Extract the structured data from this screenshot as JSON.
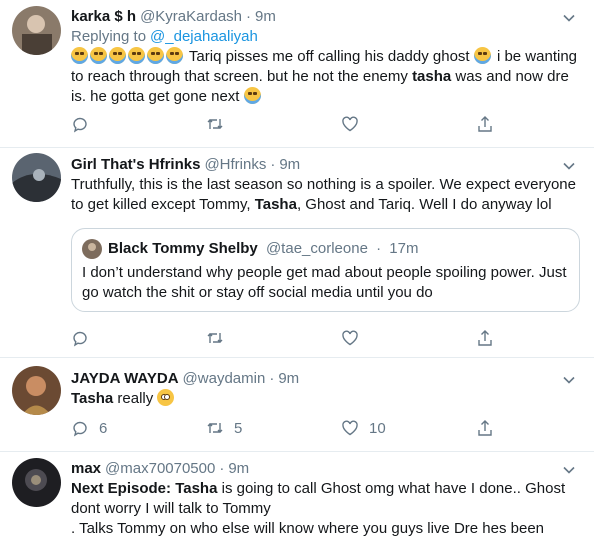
{
  "tweets": [
    {
      "name": "karka",
      "name_suffix": "$ h",
      "handle": "@KyraKardash",
      "dot": "·",
      "time": "9m",
      "replying_label": "Replying to",
      "replying_to": "@_dejahaaliyah",
      "text_parts": [
        " Tariq pisses me off calling his daddy ghost ",
        " i be wanting to reach through that screen. but he not the enemy ",
        "tasha",
        " was and now dre is. he gotta get gone next "
      ],
      "emoji": "loudly-crying-face",
      "actions": {
        "reply": "",
        "retweet": "",
        "like": ""
      }
    },
    {
      "name": "Girl That's Hfrinks",
      "handle": "@Hfrinks",
      "dot": "·",
      "time": "9m",
      "text_parts": [
        "Truthfully, this is the last season so nothing is a spoiler. We expect everyone to get killed except Tommy, ",
        "Tasha",
        ", Ghost and Tariq. Well I do anyway lol"
      ],
      "quote": {
        "name": "Black Tommy Shelby",
        "handle": "@tae_corleone",
        "dot": "·",
        "time": "17m",
        "text": "I don’t understand why people get mad about people spoiling power. Just go watch the shit or stay off social media until you do"
      },
      "actions": {
        "reply": "",
        "retweet": "",
        "like": ""
      }
    },
    {
      "name": "JAYDA WAYDA",
      "handle": "@waydamin",
      "dot": "·",
      "time": "9m",
      "text_parts": [
        "Tasha",
        " really "
      ],
      "emoji": "flushed-face",
      "actions": {
        "reply": "6",
        "retweet": "5",
        "like": "10"
      }
    },
    {
      "name": "max",
      "handle": "@max70070500",
      "dot": "·",
      "time": "9m",
      "text_parts": [
        "Next Episode: ",
        "Tasha",
        " is going to call Ghost omg what have I done.. Ghost dont worry I will talk to Tommy",
        ". Talks Tommy on who else will know where you guys live Dre hes been"
      ]
    }
  ],
  "colors": {
    "text": "#14171a",
    "secondary": "#657786",
    "link": "#1b95e0",
    "border": "#e6ecf0"
  }
}
